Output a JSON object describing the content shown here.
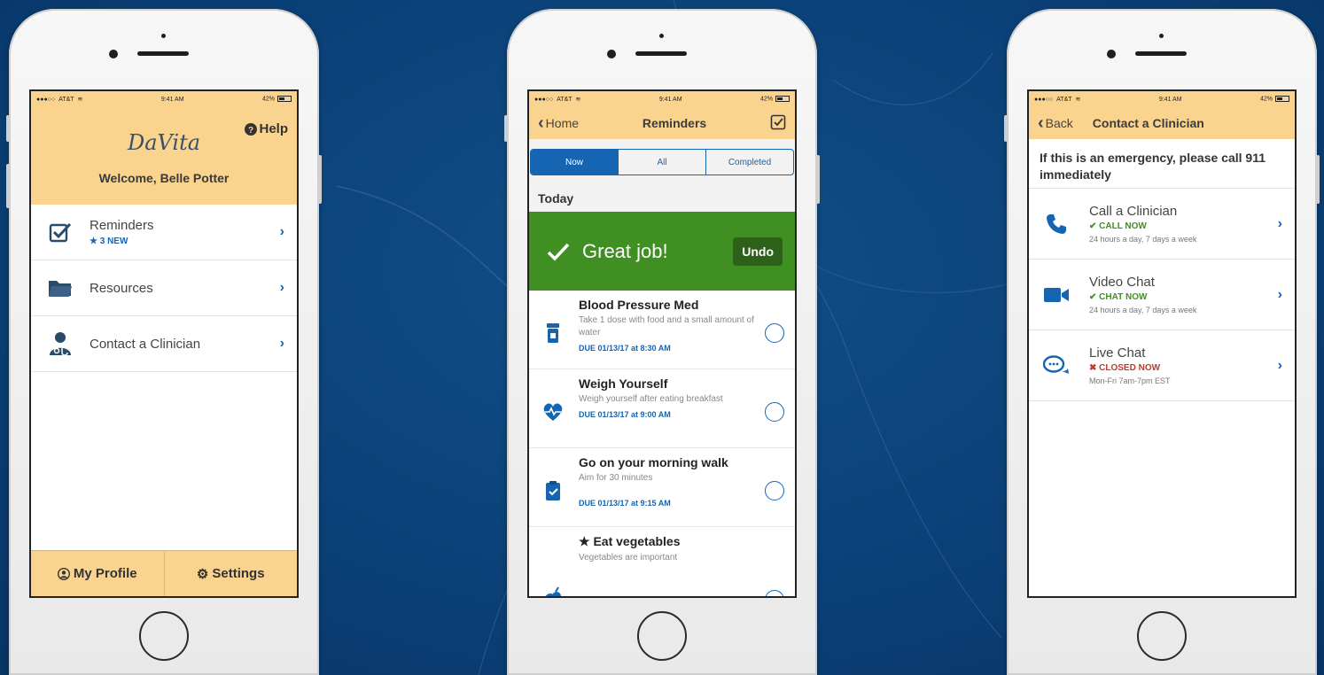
{
  "colors": {
    "accent": "#1565b2",
    "header": "#fad38f",
    "success": "#3f8f22",
    "danger": "#c0392b",
    "background": "#0b4178"
  },
  "status": {
    "carrier": "AT&T",
    "time": "9:41 AM",
    "battery": "42%"
  },
  "home": {
    "logo": "DaVita",
    "help_label": "Help",
    "welcome": "Welcome, Belle Potter",
    "menu": [
      {
        "label": "Reminders",
        "badge": "★ 3 NEW",
        "icon": "checkbox-icon"
      },
      {
        "label": "Resources",
        "badge": "",
        "icon": "folder-icon"
      },
      {
        "label": "Contact a Clinician",
        "badge": "",
        "icon": "clinician-icon"
      }
    ],
    "tabs": {
      "profile": "My Profile",
      "settings": "Settings"
    }
  },
  "reminders": {
    "back_label": "Home",
    "title": "Reminders",
    "segments": [
      "Now",
      "All",
      "Completed"
    ],
    "active_segment": "Now",
    "section": "Today",
    "banner": {
      "text": "Great job!",
      "undo": "Undo"
    },
    "items": [
      {
        "title": "Blood Pressure Med",
        "desc": "Take 1 dose with food and a small amount of water",
        "due": "DUE 01/13/17 at 8:30 AM",
        "icon": "pill-bottle-icon"
      },
      {
        "title": "Weigh Yourself",
        "desc": "Weigh yourself after eating breakfast",
        "due": "DUE 01/13/17 at 9:00 AM",
        "icon": "heart-rate-icon"
      },
      {
        "title": "Go on your morning walk",
        "desc": "Aim for 30 minutes",
        "due": "DUE 01/13/17 at 9:15 AM",
        "icon": "clipboard-check-icon"
      },
      {
        "title": "★ Eat vegetables",
        "desc": "Vegetables are important",
        "due": "",
        "icon": "vegetables-icon"
      }
    ]
  },
  "contact": {
    "back_label": "Back",
    "title": "Contact a Clinician",
    "emergency": "If this is an emergency, please call 911 immediately",
    "options": [
      {
        "title": "Call a Clinician",
        "status": "✔ CALL NOW",
        "hours": "24 hours a day, 7 days a week",
        "icon": "phone-icon"
      },
      {
        "title": "Video Chat",
        "status": "✔ CHAT NOW",
        "hours": "24 hours a day, 7 days a week",
        "icon": "video-camera-icon"
      },
      {
        "title": "Live Chat",
        "status": "✖ CLOSED NOW",
        "hours": "Mon-Fri 7am-7pm EST",
        "icon": "chat-bubbles-icon"
      }
    ]
  }
}
